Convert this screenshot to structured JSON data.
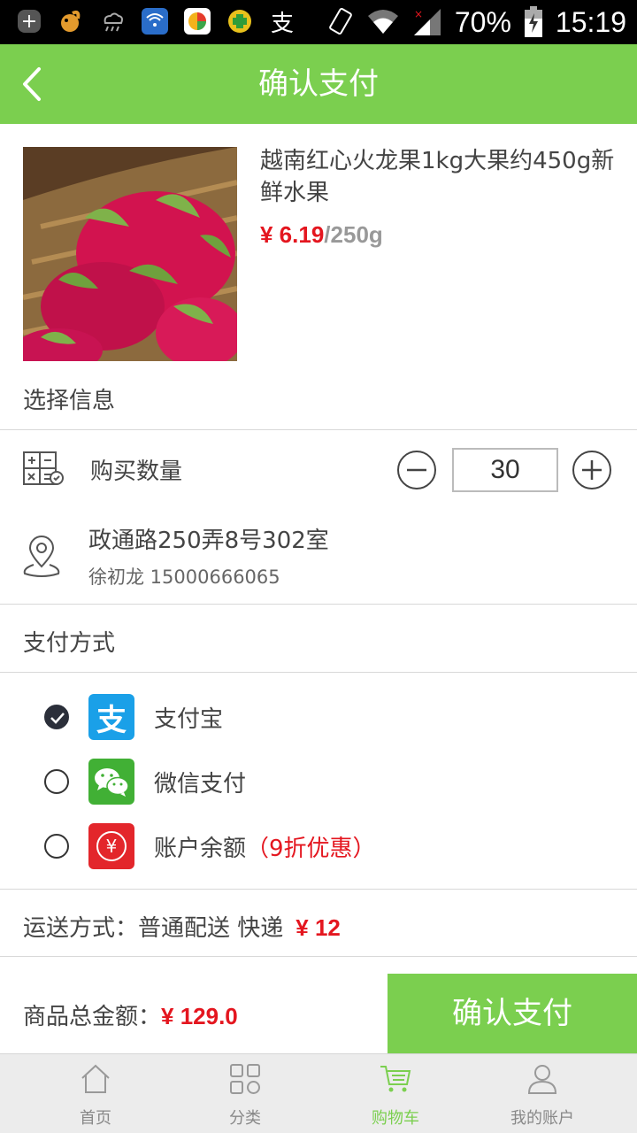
{
  "status_bar": {
    "battery": "70%",
    "time": "15:19",
    "alipay_glyph": "支",
    "icons": [
      "add-icon",
      "squirrel-browser-icon",
      "cloud-rain-icon",
      "wifi-app-icon",
      "colorful-app-icon",
      "cross-app-icon",
      "alipay-icon",
      "phone-rotate-icon",
      "wifi-icon",
      "signal-icon",
      "battery-icon"
    ]
  },
  "header": {
    "title": "确认支付",
    "back_icon": "chevron-left-icon"
  },
  "product": {
    "name": "越南红心火龙果1kg大果约450g新鲜水果",
    "price": "¥ 6.19",
    "unit": "/250g",
    "image_icon": "dragon-fruit-image"
  },
  "select_info": {
    "title": "选择信息",
    "quantity_label": "购买数量",
    "quantity": "30",
    "address_line": "政通路250弄8号302室",
    "contact": "徐初龙 15000666065"
  },
  "payment": {
    "title": "支付方式",
    "options": [
      {
        "label": "支付宝",
        "icon": "alipay-logo-icon",
        "glyph": "支",
        "selected": true
      },
      {
        "label": "微信支付",
        "icon": "wechat-logo-icon",
        "selected": false
      },
      {
        "label": "账户余额",
        "discount": "（9折优惠）",
        "icon": "balance-logo-icon",
        "glyph": "¥",
        "selected": false
      }
    ]
  },
  "shipping": {
    "label": "运送方式：普通配送  快递",
    "fee": "¥ 12"
  },
  "footer": {
    "total_label": "商品总金额：",
    "total_amount": "¥ 129.0",
    "confirm_label": "确认支付"
  },
  "tabs": [
    {
      "label": "首页",
      "icon": "home-icon",
      "active": false
    },
    {
      "label": "分类",
      "icon": "grid-icon",
      "active": false
    },
    {
      "label": "购物车",
      "icon": "cart-icon",
      "active": true
    },
    {
      "label": "我的账户",
      "icon": "user-icon",
      "active": false
    }
  ],
  "colors": {
    "brand_green": "#7bcf4f",
    "price_red": "#e4161f",
    "alipay_blue": "#1aa0e8",
    "wechat_green": "#41b035",
    "balance_red": "#e3262b"
  }
}
